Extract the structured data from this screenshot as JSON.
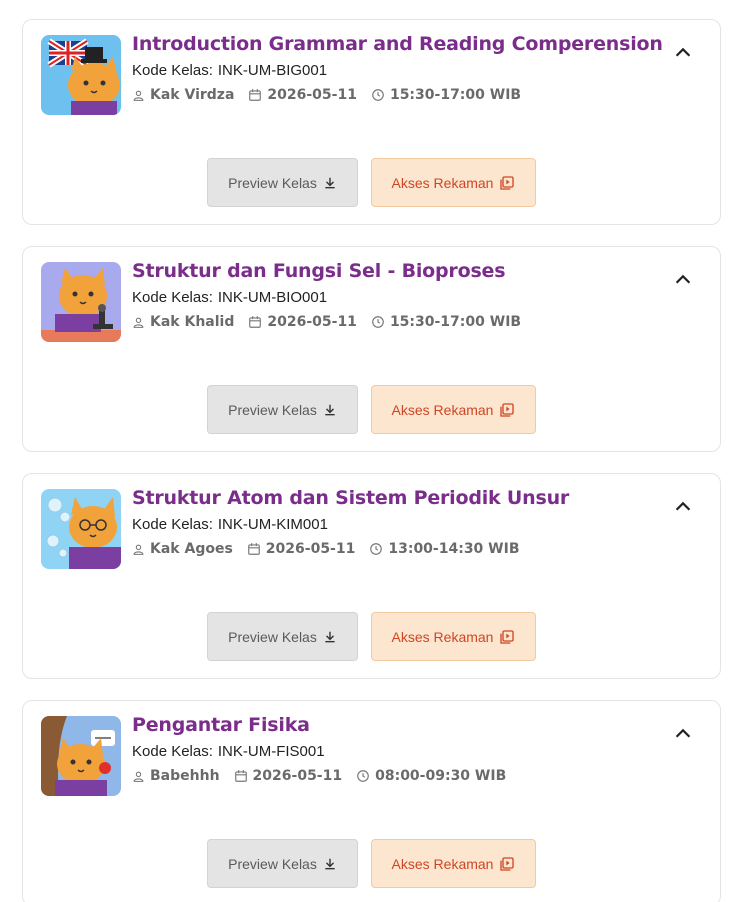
{
  "colors": {
    "title": "#7b2d8b",
    "akses_text": "#d04524",
    "akses_bg": "#fde6cf",
    "preview_bg": "#e4e4e4"
  },
  "classes": [
    {
      "title": "Introduction Grammar and Reading Comperension",
      "code_label": "Kode Kelas:",
      "code": "INK-UM-BIG001",
      "teacher": "Kak Virdza",
      "date": "2026-05-11",
      "time": "15:30-17:00 WIB",
      "preview_label": "Preview Kelas",
      "akses_label": "Akses Rekaman",
      "thumbnail_icon": "cat-with-uk-flag-icon"
    },
    {
      "title": "Struktur dan Fungsi Sel - Bioproses",
      "code_label": "Kode Kelas:",
      "code": "INK-UM-BIO001",
      "teacher": "Kak Khalid",
      "date": "2026-05-11",
      "time": "15:30-17:00 WIB",
      "preview_label": "Preview Kelas",
      "akses_label": "Akses Rekaman",
      "thumbnail_icon": "cat-with-microscope-icon"
    },
    {
      "title": "Struktur Atom dan Sistem Periodik Unsur",
      "code_label": "Kode Kelas:",
      "code": "INK-UM-KIM001",
      "teacher": "Kak Agoes",
      "date": "2026-05-11",
      "time": "13:00-14:30 WIB",
      "preview_label": "Preview Kelas",
      "akses_label": "Akses Rekaman",
      "thumbnail_icon": "cat-with-molecules-icon"
    },
    {
      "title": "Pengantar Fisika",
      "code_label": "Kode Kelas:",
      "code": "INK-UM-FIS001",
      "teacher": "Babehhh",
      "date": "2026-05-11",
      "time": "08:00-09:30 WIB",
      "preview_label": "Preview Kelas",
      "akses_label": "Akses Rekaman",
      "thumbnail_icon": "cat-with-apple-icon"
    }
  ]
}
